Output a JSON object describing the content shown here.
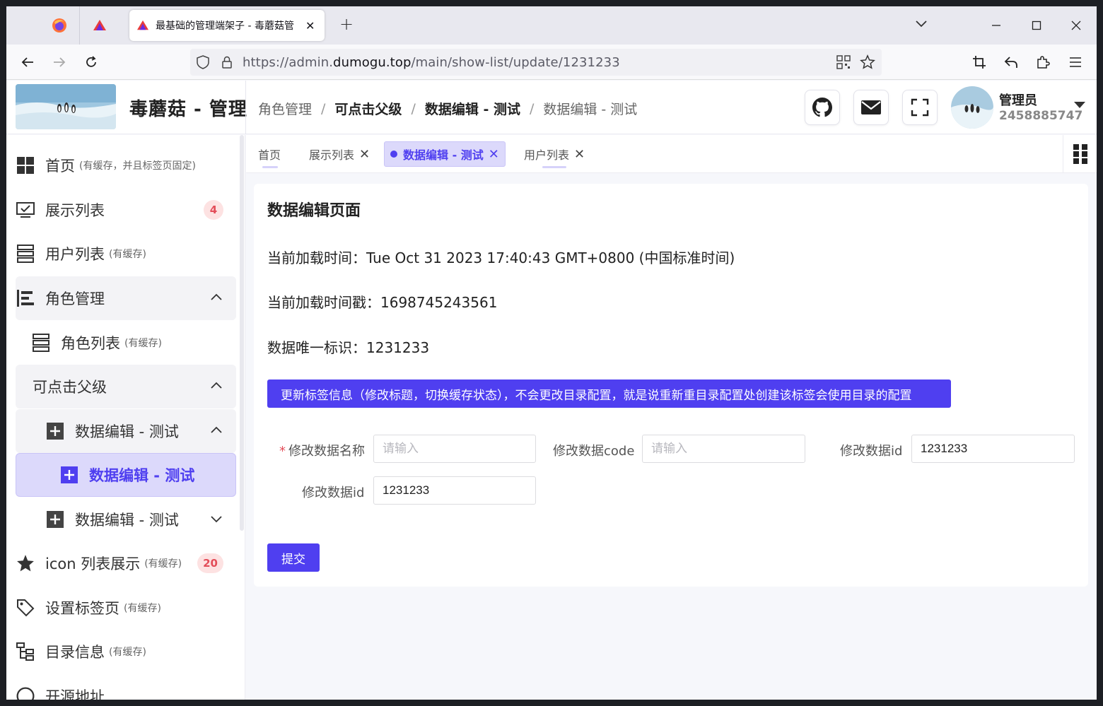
{
  "browser": {
    "active_tab_title": "最基础的管理端架子 - 毒蘑菇管",
    "close": "✕",
    "new_tab": "+",
    "url_prefix": "https://admin.",
    "url_domain": "dumogu.top",
    "url_path": "/main/show-list/update/1231233"
  },
  "header": {
    "app_title": "毒蘑菇 - 管理",
    "breadcrumb": [
      "角色管理",
      "可点击父级",
      "数据编辑 - 测试",
      "数据编辑 - 测试"
    ],
    "breadcrumb_sep": "/",
    "user_name": "管理员",
    "user_id": "2458885747"
  },
  "sidebar": {
    "items": [
      {
        "label": "首页",
        "note": "(有缓存，并且标签页固定)",
        "icon": "dashboard-icon"
      },
      {
        "label": "展示列表",
        "badge": "4",
        "icon": "monitor-check-icon"
      },
      {
        "label": "用户列表",
        "note": "(有缓存)",
        "icon": "list-icon"
      },
      {
        "label": "角色管理",
        "icon": "align-icon"
      },
      {
        "label": "角色列表",
        "note": "(有缓存)",
        "icon": "list-icon"
      },
      {
        "label": "可点击父级"
      },
      {
        "label": "数据编辑 - 测试",
        "icon": "plus-square-icon"
      },
      {
        "label": "数据编辑 - 测试",
        "icon": "plus-square-icon"
      },
      {
        "label": "数据编辑 - 测试",
        "icon": "plus-square-icon"
      },
      {
        "label": "icon 列表展示",
        "note": "(有缓存)",
        "badge": "20",
        "icon": "star-icon"
      },
      {
        "label": "设置标签页",
        "note": "(有缓存)",
        "icon": "tag-icon"
      },
      {
        "label": "目录信息",
        "note": "(有缓存)",
        "icon": "tree-icon"
      },
      {
        "label": "开源地址",
        "icon": "github-icon"
      }
    ]
  },
  "tabs": [
    {
      "label": "首页"
    },
    {
      "label": "展示列表"
    },
    {
      "label": "数据编辑 - 测试"
    },
    {
      "label": "用户列表"
    }
  ],
  "content": {
    "title": "数据编辑页面",
    "load_time_label": "当前加载时间：",
    "load_time_value": "Tue Oct 31 2023 17:40:43 GMT+0800 (中国标准时间)",
    "timestamp_label": "当前加载时间戳：",
    "timestamp_value": "1698745243561",
    "id_label": "数据唯一标识：",
    "id_value": "1231233",
    "banner": "更新标签信息（修改标题，切换缓存状态），不会更改目录配置，就是说重新重目录配置处创建该标签会使用目录的配置",
    "form": {
      "required_mark": "*",
      "name_label": "修改数据名称",
      "name_placeholder": "请输入",
      "code_label": "修改数据code",
      "code_placeholder": "请输入",
      "id_label": "修改数据id",
      "id_value": "1231233",
      "id2_label": "修改数据id",
      "id2_value": "1231233"
    },
    "submit_label": "提交"
  },
  "colors": {
    "accent": "#4f3ff0",
    "accent_light": "#dcd9fb",
    "badge_bg": "#fde2e2",
    "badge_text": "#e34d59"
  }
}
